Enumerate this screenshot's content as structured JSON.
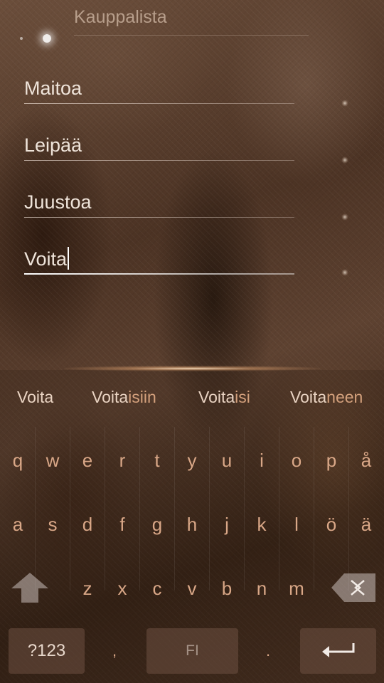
{
  "header": {
    "title": "Kauppalista"
  },
  "list": {
    "items": [
      {
        "text": "Maitoa"
      },
      {
        "text": "Leipää"
      },
      {
        "text": "Juustoa"
      },
      {
        "text": "Voita"
      }
    ]
  },
  "predictions": [
    {
      "typed": "Voita",
      "rest": ""
    },
    {
      "typed": "Voita",
      "rest": "isiin"
    },
    {
      "typed": "Voita",
      "rest": "isi"
    },
    {
      "typed": "Voita",
      "rest": "neen"
    }
  ],
  "keyboard": {
    "row1": [
      "q",
      "w",
      "e",
      "r",
      "t",
      "y",
      "u",
      "i",
      "o",
      "p",
      "å"
    ],
    "row2": [
      "a",
      "s",
      "d",
      "f",
      "g",
      "h",
      "j",
      "k",
      "l",
      "ö",
      "ä"
    ],
    "row3": [
      "z",
      "x",
      "c",
      "v",
      "b",
      "n",
      "m"
    ],
    "symbols_label": "?123",
    "comma": ",",
    "language_label": "FI",
    "period": ".",
    "shift_icon": "shift-arrow-icon",
    "backspace_icon": "backspace-icon",
    "enter_icon": "enter-icon"
  },
  "colors": {
    "key_text": "#d9a787",
    "prediction": "#d3a07c",
    "prediction_highlight": "#e9d3c2"
  }
}
